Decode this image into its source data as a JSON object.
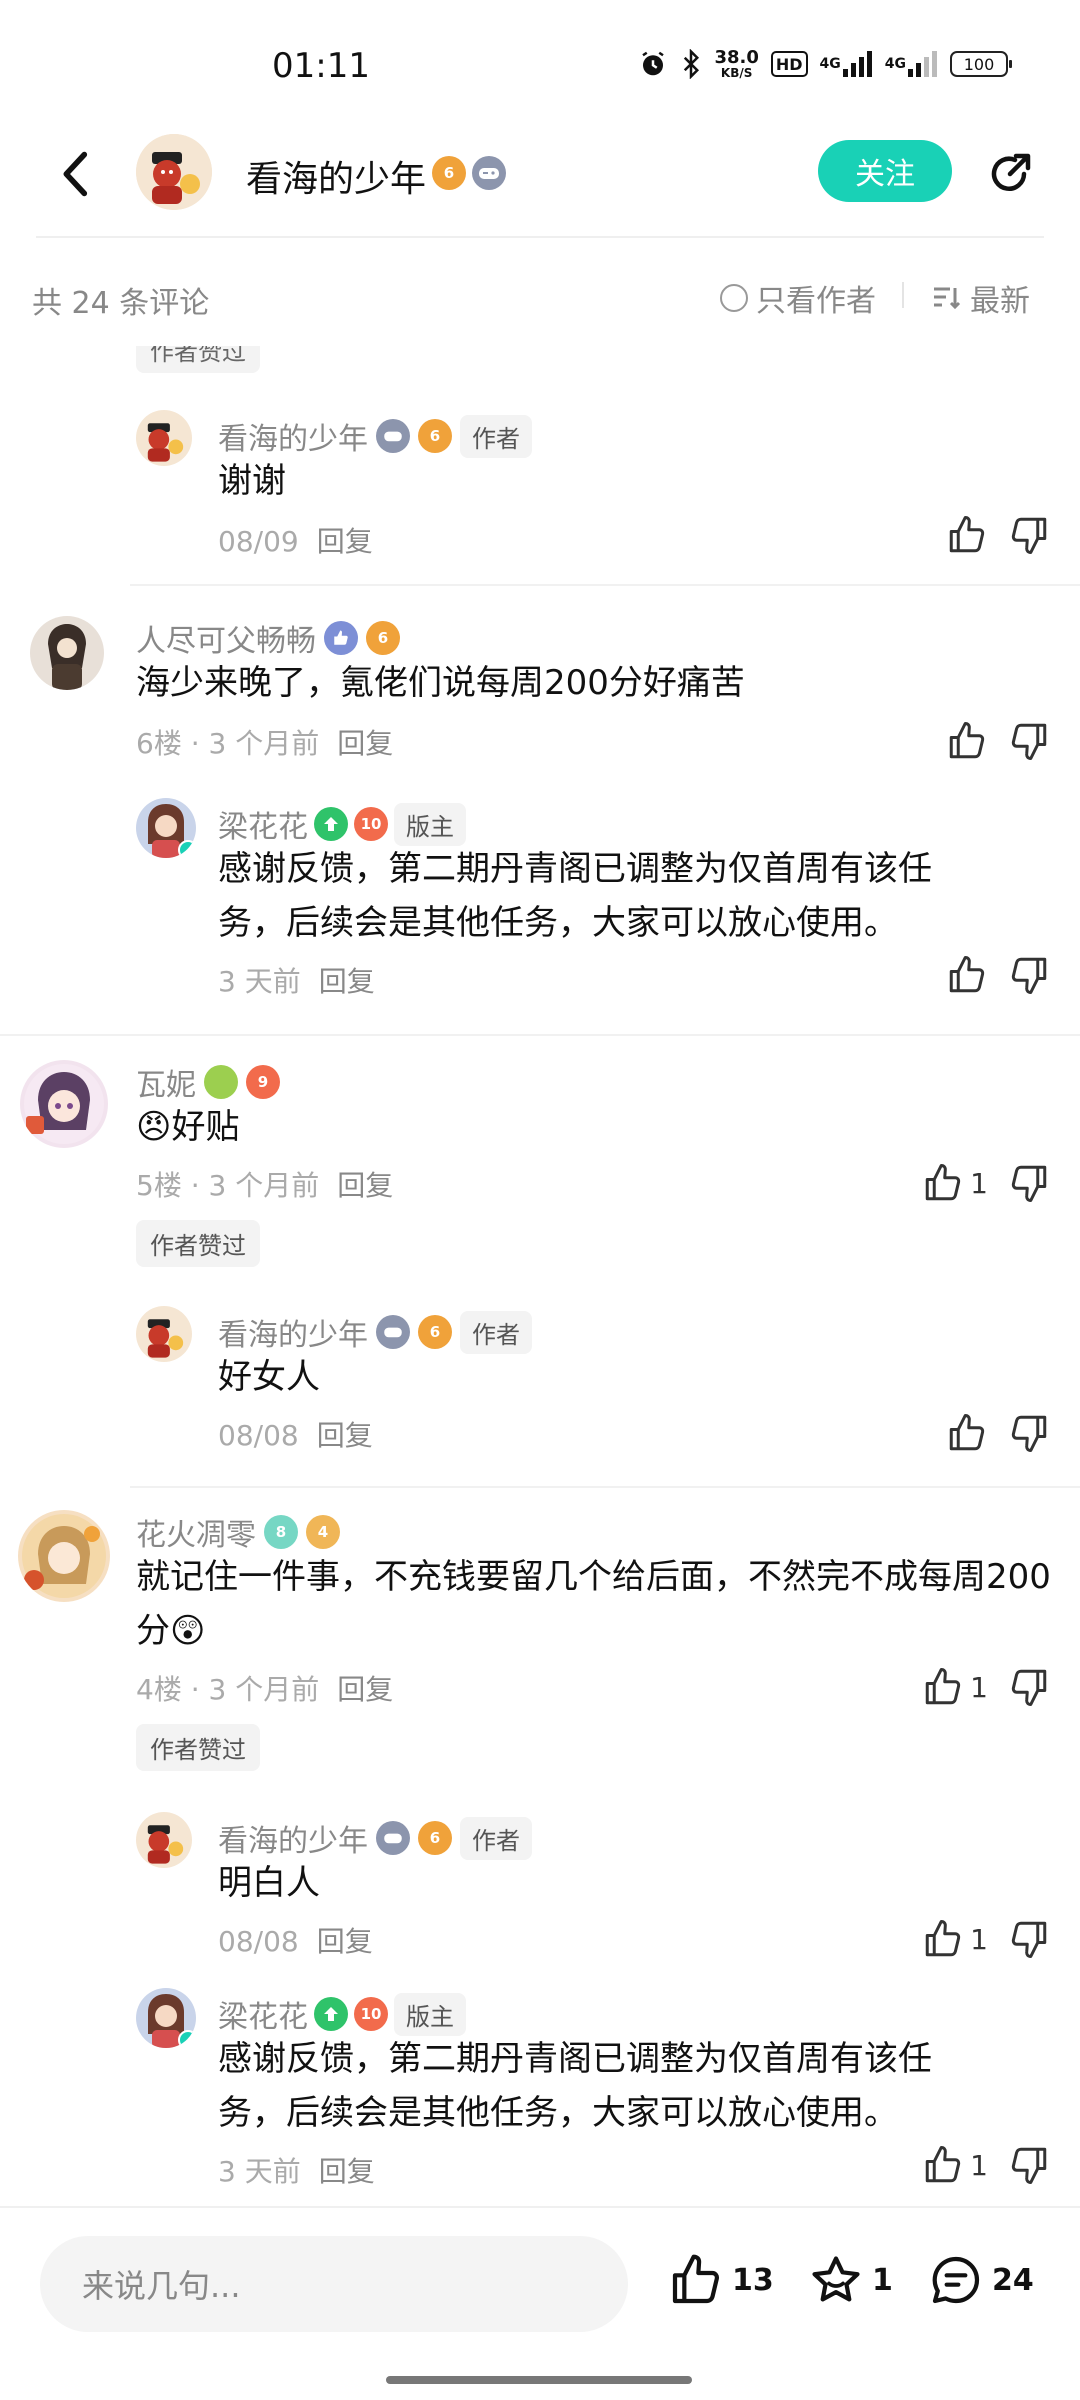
{
  "status": {
    "time": "01:11",
    "net_speed": "38.0",
    "net_unit": "KB/S",
    "hd": "HD",
    "signal1": "4G",
    "signal2": "4G",
    "battery": "100"
  },
  "header": {
    "title": "看海的少年",
    "follow_label": "关注"
  },
  "filter": {
    "count_label": "共 24 条评论",
    "only_author_label": "只看作者",
    "sort_label": "最新"
  },
  "feed": {
    "cut_tag": "作者赞过",
    "reply_label": "回复",
    "liked_tag": "作者赞过",
    "author_tag": "作者",
    "mod_tag": "版主",
    "r1": {
      "name": "看海的少年",
      "text": "谢谢",
      "date": "08/09"
    },
    "c6": {
      "name": "人尽可父畅畅",
      "text": "海少来晚了，氪佬们说每周200分好痛苦",
      "meta": "6楼 · 3 个月前"
    },
    "r2": {
      "name": "梁花花",
      "text": "感谢反馈，第二期丹青阁已调整为仅首周有该任务，后续会是其他任务，大家可以放心使用。",
      "date": "3 天前"
    },
    "c5": {
      "name": "瓦妮",
      "emoji": "😠",
      "text": "好贴",
      "meta": "5楼 · 3 个月前",
      "likes": "1"
    },
    "r3": {
      "name": "看海的少年",
      "text": "好女人",
      "date": "08/08"
    },
    "c4": {
      "name": "花火凋零",
      "text": "就记住一件事，不充钱要留几个给后面，不然完不成每周200分",
      "emoji": "😲",
      "meta": "4楼 · 3 个月前",
      "likes": "1"
    },
    "r4": {
      "name": "看海的少年",
      "text": "明白人",
      "date": "08/08",
      "likes": "1"
    },
    "r5": {
      "name": "梁花花",
      "text": "感谢反馈，第二期丹青阁已调整为仅首周有该任务，后续会是其他任务，大家可以放心使用。",
      "date": "3 天前",
      "likes": "1"
    }
  },
  "badges": {
    "t6": "6",
    "t10": "10",
    "t9": "9",
    "t4": "4",
    "lv8": "8"
  },
  "bottom": {
    "input_placeholder": "来说几句...",
    "like_count": "13",
    "fav_count": "1",
    "comment_count": "24"
  }
}
